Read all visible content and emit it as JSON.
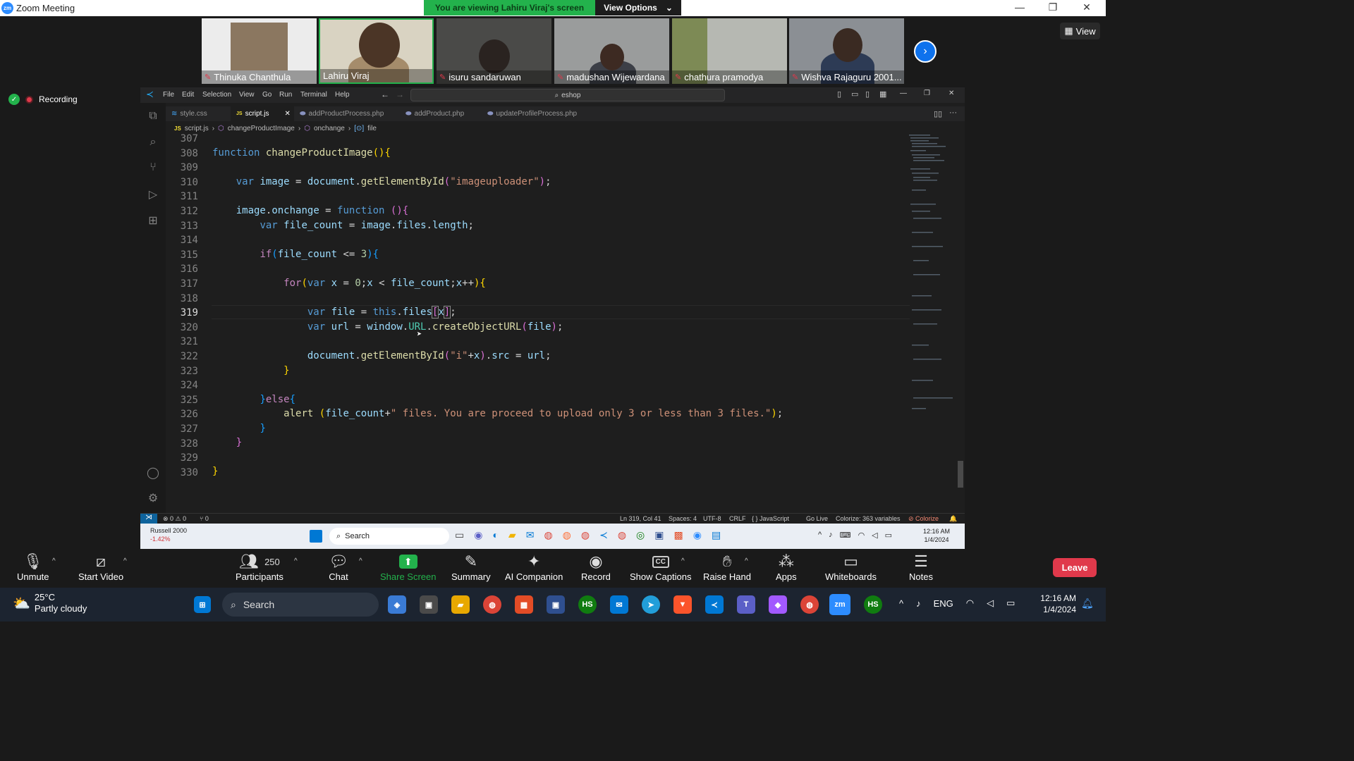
{
  "window": {
    "title": "Zoom Meeting",
    "minimize": "—",
    "maximize": "❐",
    "close": "✕"
  },
  "banner": {
    "message": "You are viewing Lahiru Viraj's screen",
    "view_options": "View Options",
    "chevron": "⌄"
  },
  "participants_strip": [
    {
      "name": "Thinuka Chanthula",
      "muted": true,
      "bg": "#e9e9e9"
    },
    {
      "name": "Lahiru Viraj",
      "muted": false,
      "bg": "#c9c4b6"
    },
    {
      "name": "isuru sandaruwan",
      "muted": true,
      "bg": "#4a4a48"
    },
    {
      "name": "madushan Wijewardana",
      "muted": true,
      "bg": "#9a9c9c"
    },
    {
      "name": "chathura pramodya",
      "muted": true,
      "bg": "#7d8a55"
    },
    {
      "name": "Wishva Rajaguru 2001...",
      "muted": true,
      "bg": "#8b8f94"
    }
  ],
  "view_button": "View",
  "recording": "Recording",
  "vscode": {
    "menu": [
      "File",
      "Edit",
      "Selection",
      "View",
      "Go",
      "Run",
      "Terminal",
      "Help"
    ],
    "search": "eshop",
    "tabs": [
      {
        "label": "style.css",
        "icon": "≋",
        "color": "#42a5f5"
      },
      {
        "label": "script.js",
        "icon": "JS",
        "color": "#f1dd35",
        "close": "✕"
      },
      {
        "label": "addProductProcess.php",
        "icon": "⬬",
        "color": "#8892bf"
      },
      {
        "label": "addProduct.php",
        "icon": "⬬",
        "color": "#8892bf"
      },
      {
        "label": "updateProfileProcess.php",
        "icon": "⬬",
        "color": "#8892bf"
      }
    ],
    "breadcrumbs": [
      "script.js",
      "changeProductImage",
      "onchange",
      "file"
    ],
    "line_numbers": [
      "307",
      "308",
      "309",
      "310",
      "311",
      "312",
      "313",
      "314",
      "315",
      "316",
      "317",
      "318",
      "319",
      "320",
      "321",
      "322",
      "323",
      "324",
      "325",
      "326",
      "327",
      "328",
      "329",
      "330"
    ],
    "current_line": "319",
    "status": {
      "problems": "⊗ 0 ⚠ 0",
      "ports": "⑂ 0",
      "position": "Ln 319, Col 41",
      "spaces": "Spaces: 4",
      "encoding": "UTF-8",
      "eol": "CRLF",
      "language": "{ } JavaScript",
      "golive": "Go Live",
      "colorize": "Colorize: 363 variables",
      "colorize2": "⊘ Colorize"
    },
    "taskbar": {
      "stock_name": "Russell 2000",
      "stock_change": "-1.42%",
      "search": "Search",
      "time": "12:16 AM",
      "date": "1/4/2024"
    }
  },
  "controls": [
    {
      "label": "Unmute",
      "icon": "🎙"
    },
    {
      "label": "Start Video",
      "icon": "📹"
    },
    {
      "label": "Participants",
      "icon": "👥",
      "count": "250"
    },
    {
      "label": "Chat",
      "icon": "💬"
    },
    {
      "label": "Share Screen",
      "icon": "⬆"
    },
    {
      "label": "Summary",
      "icon": "✎"
    },
    {
      "label": "AI Companion",
      "icon": "✦"
    },
    {
      "label": "Record",
      "icon": "◉"
    },
    {
      "label": "Show Captions",
      "icon": "CC"
    },
    {
      "label": "Raise Hand",
      "icon": "✋"
    },
    {
      "label": "Apps",
      "icon": "⁂"
    },
    {
      "label": "Whiteboards",
      "icon": "▭"
    },
    {
      "label": "Notes",
      "icon": "☰"
    }
  ],
  "leave": "Leave",
  "taskbar": {
    "temp": "25°C",
    "weather": "Partly cloudy",
    "search": "Search",
    "lang": "ENG",
    "time": "12:16 AM",
    "date": "1/4/2024"
  },
  "colors": {
    "zoom_blue": "#0e72ed",
    "leave_red": "#e0394b",
    "share_green": "#23b24c"
  }
}
